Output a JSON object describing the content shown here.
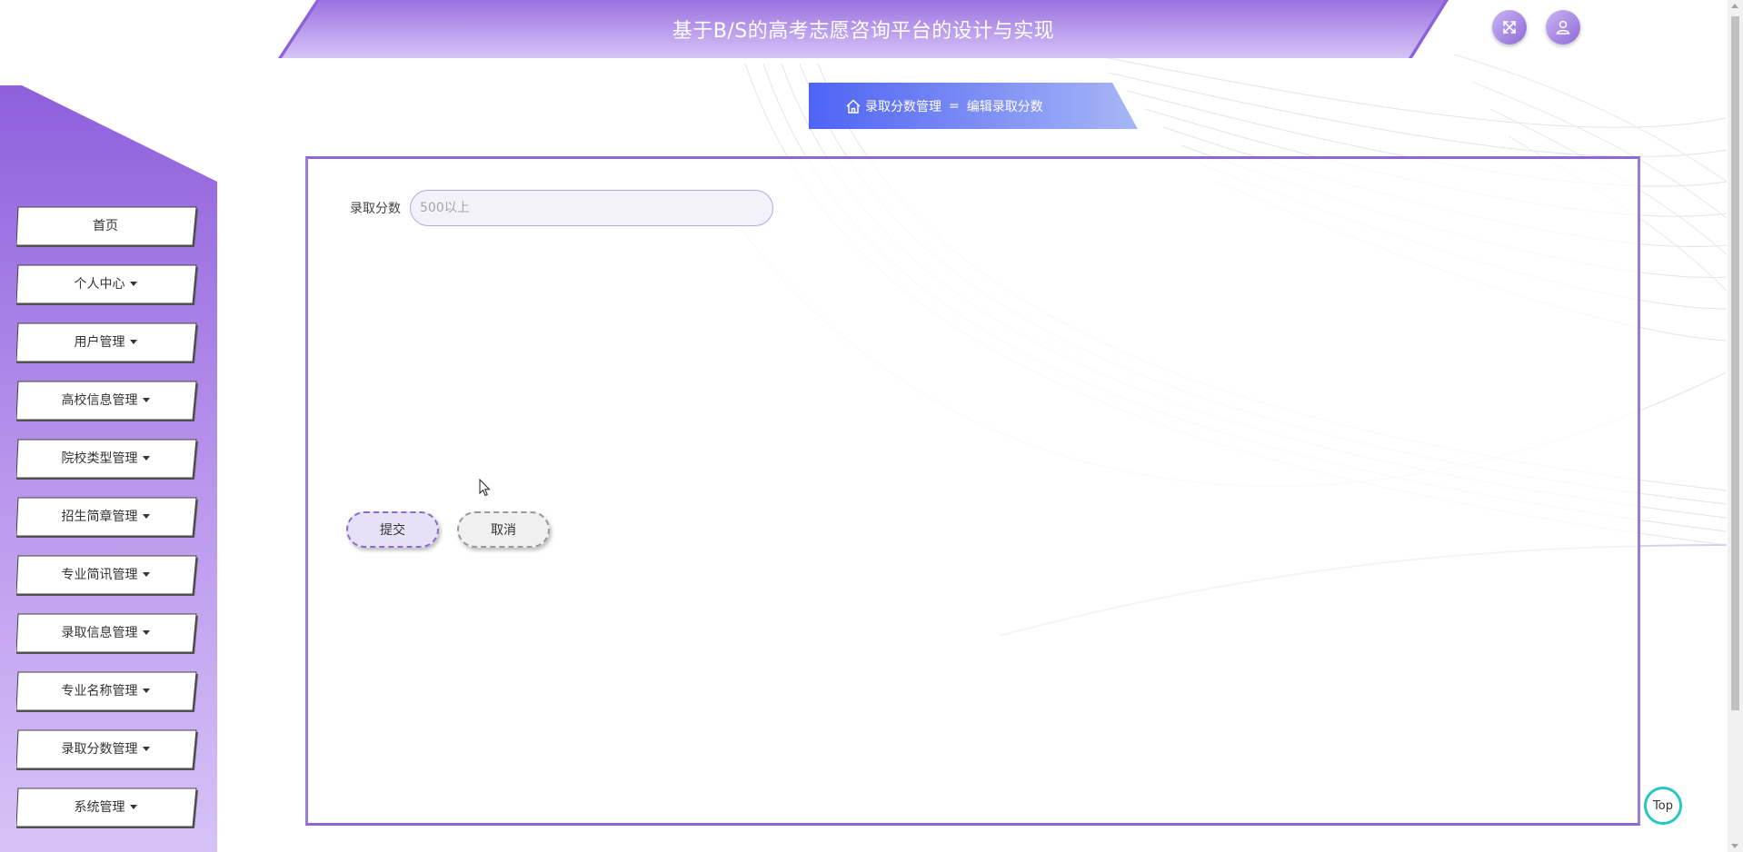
{
  "header": {
    "title": "基于B/S的高考志愿咨询平台的设计与实现",
    "fullscreen_icon": "expand-icon",
    "user_icon": "user-icon"
  },
  "sidebar": {
    "items": [
      {
        "label": "首页",
        "has_caret": false
      },
      {
        "label": "个人中心",
        "has_caret": true
      },
      {
        "label": "用户管理",
        "has_caret": true
      },
      {
        "label": "高校信息管理",
        "has_caret": true
      },
      {
        "label": "院校类型管理",
        "has_caret": true
      },
      {
        "label": "招生简章管理",
        "has_caret": true
      },
      {
        "label": "专业简讯管理",
        "has_caret": true
      },
      {
        "label": "录取信息管理",
        "has_caret": true
      },
      {
        "label": "专业名称管理",
        "has_caret": true
      },
      {
        "label": "录取分数管理",
        "has_caret": true
      },
      {
        "label": "系统管理",
        "has_caret": true
      }
    ]
  },
  "breadcrumb": {
    "home_icon": "home-icon",
    "parent": "录取分数管理",
    "separator": "=",
    "current": "编辑录取分数"
  },
  "form": {
    "score_label": "录取分数",
    "score_placeholder": "500以上",
    "score_value": "",
    "submit_label": "提交",
    "cancel_label": "取消"
  },
  "top_button": {
    "label": "Top"
  },
  "colors": {
    "accent_purple": "#8e67d6",
    "header_gradient_start": "#9b72e0",
    "header_gradient_end": "#d5c3f7",
    "breadcrumb_blue": "#5a6cf5",
    "top_ring": "#26c6c6"
  }
}
